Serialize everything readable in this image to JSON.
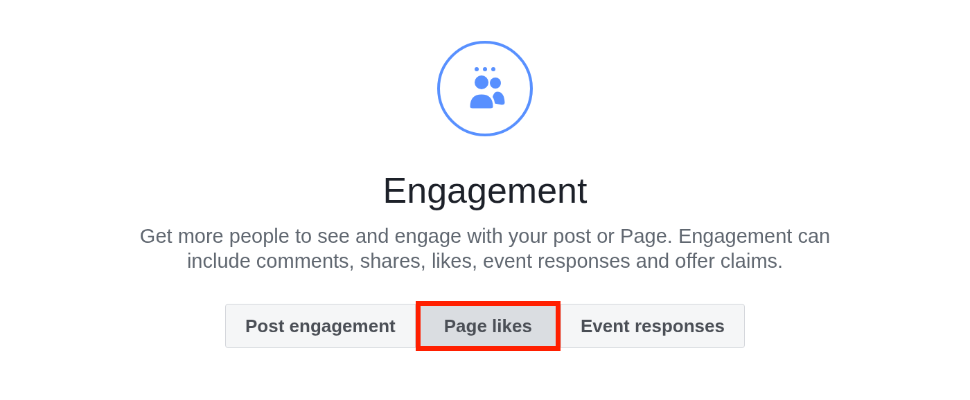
{
  "title": "Engagement",
  "description": "Get more people to see and engage with your post or Page. Engagement can include comments, shares, likes, event responses and offer claims.",
  "options": [
    {
      "label": "Post engagement",
      "selected": false,
      "highlighted": false
    },
    {
      "label": "Page likes",
      "selected": true,
      "highlighted": true
    },
    {
      "label": "Event responses",
      "selected": false,
      "highlighted": false
    }
  ]
}
